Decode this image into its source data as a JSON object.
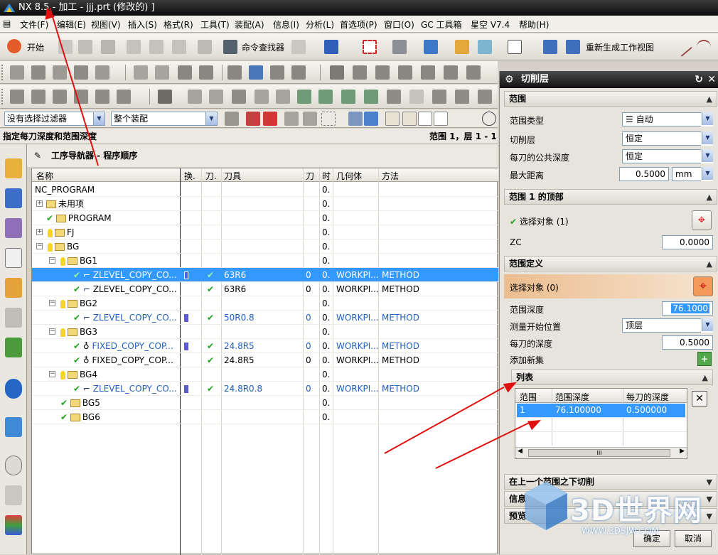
{
  "window": {
    "title": "NX 8.5 - 加工 - jjj.prt (修改的) ]"
  },
  "menu": [
    "文件(F)",
    "编辑(E)",
    "视图(V)",
    "插入(S)",
    "格式(R)",
    "工具(T)",
    "装配(A)",
    "信息(I)",
    "分析(L)",
    "首选项(P)",
    "窗口(O)",
    "GC 工具箱",
    "星空 V7.4",
    "帮助(H)"
  ],
  "toolbar": {
    "start_label": "开始",
    "cmd_finder": "命令查找器",
    "regen_label": "重新生成工作视图"
  },
  "filter": {
    "type_filter": "没有选择过滤器",
    "scope": "整个装配"
  },
  "status": {
    "prompt": "指定每刀深度和范围深度",
    "right": "范围 1，层 1 - 1"
  },
  "navigator": {
    "title": "工序导航器 - 程序顺序",
    "columns": [
      "名称",
      "换.",
      "刀.",
      "刀具",
      "刀",
      "时",
      "几何体",
      "方法"
    ],
    "rows": [
      {
        "name": "NC_PROGRAM",
        "cnt": "",
        "time": "0.",
        "geom": "",
        "method": "",
        "tool": ""
      },
      {
        "name": "未用项",
        "cnt": "",
        "time": "0.",
        "geom": "",
        "method": "",
        "tool": ""
      },
      {
        "name": "PROGRAM",
        "cnt": "",
        "time": "0.",
        "geom": "",
        "method": "",
        "tool": ""
      },
      {
        "name": "FJ",
        "cnt": "",
        "time": "0.",
        "geom": "",
        "method": "",
        "tool": ""
      },
      {
        "name": "BG",
        "cnt": "",
        "time": "0.",
        "geom": "",
        "method": "",
        "tool": ""
      },
      {
        "name": "BG1",
        "cnt": "",
        "time": "0.",
        "geom": "",
        "method": "",
        "tool": ""
      },
      {
        "name": "ZLEVEL_COPY_CO...",
        "cnt": "0",
        "time": "0.",
        "geom": "WORKPI...",
        "method": "METHOD",
        "tool": "63R6"
      },
      {
        "name": "ZLEVEL_COPY_CO...",
        "cnt": "0",
        "time": "0.",
        "geom": "WORKPI...",
        "method": "METHOD",
        "tool": "63R6"
      },
      {
        "name": "BG2",
        "cnt": "",
        "time": "0.",
        "geom": "",
        "method": "",
        "tool": ""
      },
      {
        "name": "ZLEVEL_COPY_CO...",
        "cnt": "0",
        "time": "0.",
        "geom": "WORKPI...",
        "method": "METHOD",
        "tool": "50R0.8"
      },
      {
        "name": "BG3",
        "cnt": "",
        "time": "0.",
        "geom": "",
        "method": "",
        "tool": ""
      },
      {
        "name": "FIXED_COPY_COP...",
        "cnt": "0",
        "time": "0.",
        "geom": "WORKPI...",
        "method": "METHOD",
        "tool": "24.8R5"
      },
      {
        "name": "FIXED_COPY_COP...",
        "cnt": "0",
        "time": "0.",
        "geom": "WORKPI...",
        "method": "METHOD",
        "tool": "24.8R5"
      },
      {
        "name": "BG4",
        "cnt": "",
        "time": "0.",
        "geom": "",
        "method": "",
        "tool": ""
      },
      {
        "name": "ZLEVEL_COPY_CO...",
        "cnt": "0",
        "time": "0.",
        "geom": "WORKPI...",
        "method": "METHOD",
        "tool": "24.8R0.8"
      },
      {
        "name": "BG5",
        "cnt": "",
        "time": "0.",
        "geom": "",
        "method": "",
        "tool": ""
      },
      {
        "name": "BG6",
        "cnt": "",
        "time": "0.",
        "geom": "",
        "method": "",
        "tool": ""
      }
    ]
  },
  "panel": {
    "title": "切削层",
    "sec_range": "范围",
    "range_type_label": "范围类型",
    "range_type_value": "自动",
    "cut_layer_label": "切削层",
    "cut_layer_value": "恒定",
    "common_depth_label": "每刀的公共深度",
    "common_depth_value": "恒定",
    "max_dist_label": "最大距离",
    "max_dist_value": "0.5000",
    "max_dist_unit": "mm",
    "sec_top": "范围 1 的顶部",
    "select_obj_1": "选择对象 (1)",
    "zc_label": "ZC",
    "zc_value": "0.0000",
    "sec_def": "范围定义",
    "select_obj_0": "选择对象 (0)",
    "range_depth_label": "范围深度",
    "range_depth_value": "76.1000",
    "measure_label": "测量开始位置",
    "measure_value": "顶层",
    "per_cut_label": "每刀的深度",
    "per_cut_value": "0.5000",
    "add_new_label": "添加新集",
    "sec_list": "列表",
    "list_cols": [
      "范围",
      "范围深度",
      "每刀的深度"
    ],
    "list_row": [
      "1",
      "76.100000",
      "0.500000"
    ],
    "scroll_mark": "III",
    "sec_below": "在上一个范围之下切削",
    "sec_info": "信息",
    "sec_preview": "预览",
    "ok": "确定",
    "cancel": "取消"
  },
  "watermark": {
    "brand": "3D世界网",
    "url": "WWW.3DSJW.COM"
  },
  "colors": {
    "selection": "#3399ff",
    "check": "#1ea21e",
    "arrow": "#e01010",
    "highlight": "#f2c9a0"
  }
}
